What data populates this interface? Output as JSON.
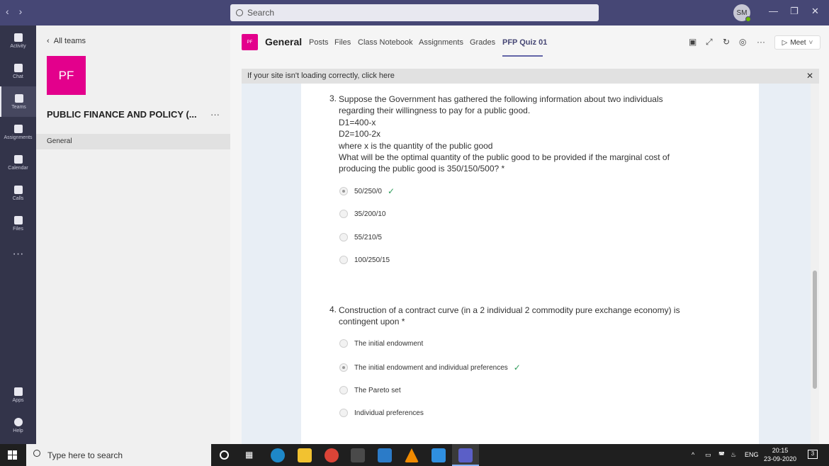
{
  "titlebar": {
    "search_placeholder": "Search",
    "avatar_initials": "SM"
  },
  "rail": [
    {
      "label": "Activity",
      "icon": "bell-icon"
    },
    {
      "label": "Chat",
      "icon": "chat-icon"
    },
    {
      "label": "Teams",
      "icon": "teams-icon"
    },
    {
      "label": "Assignments",
      "icon": "assignments-icon"
    },
    {
      "label": "Calendar",
      "icon": "calendar-icon"
    },
    {
      "label": "Calls",
      "icon": "phone-icon"
    },
    {
      "label": "Files",
      "icon": "file-icon"
    },
    {
      "label": "Apps",
      "icon": "apps-icon"
    },
    {
      "label": "Help",
      "icon": "help-icon"
    }
  ],
  "leftpane": {
    "back_label": "All teams",
    "team_initials": "PF",
    "team_name": "PUBLIC FINANCE AND POLICY (...",
    "more": "···",
    "channel": "General"
  },
  "header": {
    "team_initials": "PF",
    "channel_title": "General",
    "tabs": [
      "Posts",
      "Files",
      "Class Notebook",
      "Assignments",
      "Grades",
      "PFP Quiz 01"
    ],
    "meet_label": "Meet"
  },
  "banner": {
    "text": "If your site isn't loading correctly, click here"
  },
  "questions": [
    {
      "number": "3.",
      "lines": [
        "Suppose the Government has gathered the following information about two individuals",
        "regarding their willingness to pay for a public good.",
        "D1=400-x",
        "D2=100-2x",
        "where x is the quantity of the public good",
        "What will be the optimal quantity of the public good to be provided if the marginal cost of",
        "producing the public good is 350/150/500? *"
      ],
      "options": [
        "50/250/0",
        "35/200/10",
        "55/210/5",
        "100/250/15"
      ]
    },
    {
      "number": "4.",
      "lines": [
        "Construction of a contract curve (in a 2 individual 2 commodity pure exchange economy) is",
        "contingent upon *"
      ],
      "options": [
        "The initial endowment",
        "The initial endowment and individual preferences",
        "The Pareto set",
        "Individual preferences"
      ]
    }
  ],
  "taskbar": {
    "search_placeholder": "Type here to search",
    "lang": "ENG",
    "time": "20:15",
    "date": "23-09-2020",
    "notif_count": "3"
  }
}
